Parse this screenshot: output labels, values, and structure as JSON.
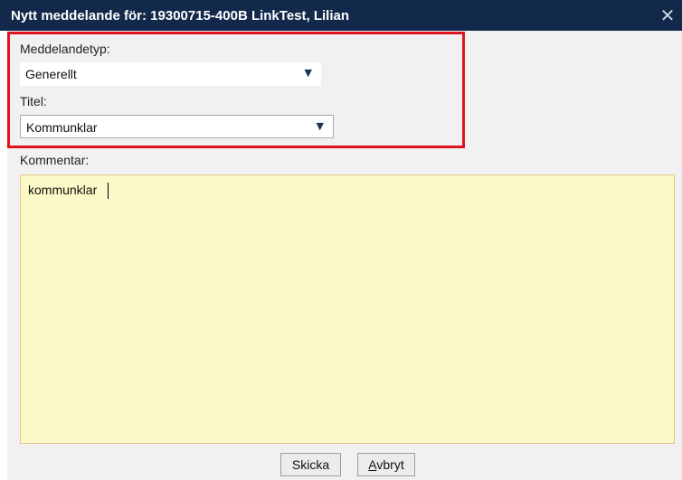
{
  "dialog": {
    "title": "Nytt meddelande för: 19300715-400B LinkTest, Lilian",
    "close_icon": "close-icon"
  },
  "form": {
    "message_type": {
      "label": "Meddelandetyp:",
      "value": "Generellt"
    },
    "title": {
      "label": "Titel:",
      "value": "Kommunklar"
    },
    "comment": {
      "label": "Kommentar:",
      "value": "kommunklar"
    }
  },
  "buttons": {
    "send_label": "Skicka",
    "cancel_label": "Avbryt",
    "cancel_accesskey": "A"
  },
  "colors": {
    "titlebar": "#13294b",
    "highlight_border": "#e0141e",
    "comment_background": "#fdf8c8"
  }
}
